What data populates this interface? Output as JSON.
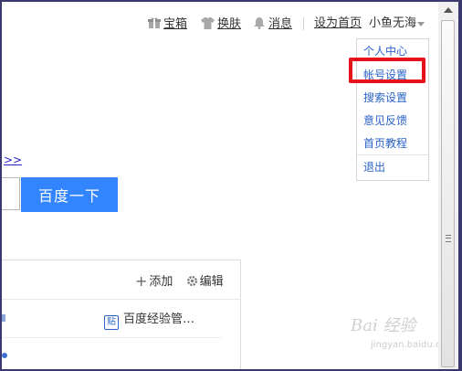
{
  "topbar": {
    "treasure": "宝箱",
    "skin": "换肤",
    "messages": "消息",
    "set_home": "设为首页",
    "user_name": "小鱼无海"
  },
  "user_menu": {
    "items": [
      "个人中心",
      "帐号设置",
      "搜索设置",
      "意见反馈",
      "首页教程",
      "退出"
    ],
    "highlighted": "帐号设置",
    "highlight_color": "#e8101a"
  },
  "main": {
    "more_link": ">>",
    "search_button": "百度一下"
  },
  "card": {
    "add_label": "添加",
    "edit_label": "编辑",
    "app_item": "百度经验管…",
    "app_icon_char": "贴"
  },
  "watermark": {
    "main": "Bai 经验",
    "sub": "jingyan.baidu.com"
  },
  "colors": {
    "accent": "#3385ff",
    "link": "#2a62c8",
    "frame": "#3b3870"
  },
  "icons": [
    "gift-icon",
    "tshirt-icon",
    "bell-icon",
    "chevron-down-icon",
    "plus-icon",
    "gear-icon",
    "app-icon"
  ]
}
